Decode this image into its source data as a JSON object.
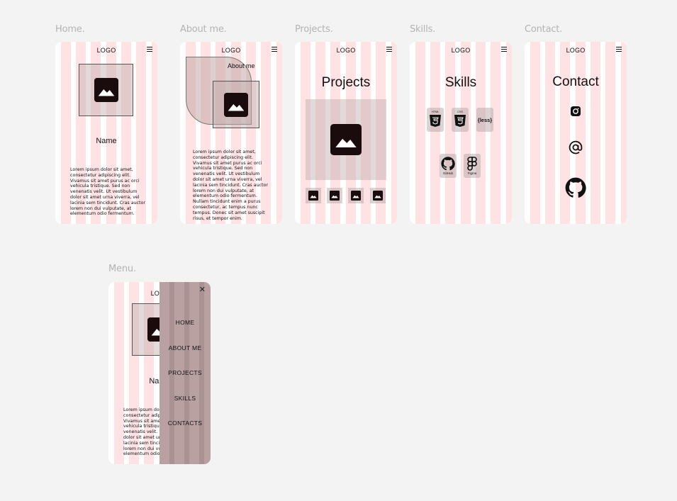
{
  "frames": {
    "home": {
      "label": "Home.",
      "logo": "LOGO",
      "name": "Name",
      "text": "Lorem ipsum dolor sit amet, consectetur adipiscing elit. Vivamus sit amet purus ac orci vehicula tristique. Sed non venenatis velit. Ut vestibulum dolor sit amet urna viverra, vel lacinia sem tincidunt. Cras auctor lorem non dui vulputate, at elementum odio fermentum."
    },
    "about": {
      "label": "About me.",
      "logo": "LOGO",
      "heading": "About  me",
      "text": "Lorem ipsum dolor sit amet, consectetur adipiscing elit. Vivamus sit amet purus ac orci vehicula tristique. Sed non venenatis velit. Ut vestibulum dolor sit amet urna viverra, vel lacinia sem tincidunt. Cras auctor lorem non dui vulputate, at elementum odio fermentum. Nullam tincidunt enim a purus consectetur, ac tempus nunc tempus. Donec sit amet suscipit risus, et tempor enim."
    },
    "projects": {
      "label": "Projects.",
      "logo": "LOGO",
      "title": "Projects"
    },
    "skills": {
      "label": "Skills.",
      "logo": "LOGO",
      "title": "Skills",
      "items": [
        {
          "icon": "html5-icon",
          "badge": "HTML"
        },
        {
          "icon": "css3-icon",
          "badge": "CSS"
        },
        {
          "icon": "less-icon",
          "badge": "{less}"
        },
        {
          "icon": "github-icon",
          "caption": "GitHub"
        },
        {
          "icon": "figma-icon",
          "caption": "Figma"
        }
      ]
    },
    "contact": {
      "label": "Contact.",
      "logo": "LOGO",
      "title": "Contact",
      "icons": [
        "instagram-icon",
        "at-sign-icon",
        "github-icon"
      ]
    },
    "menu": {
      "label": "Menu.",
      "logo": "LOGO",
      "name": "Name",
      "text": "Lorem ipsum dolor sit amet, consectetur adipiscing elit. Vivamus sit amet purus ac orci vehicula tristique. Sed non venenatis velit. Ut vestibulum dolor sit amet urna viverra, vel lacinia sem tincidunt. Cras auctor lorem non dui vulputate, at elementum odio fermentum.",
      "items": [
        "HOME",
        "ABOUT ME",
        "PROJECTS",
        "SKILLS",
        "CONTACTS"
      ]
    }
  },
  "colors": {
    "background": "#f3f3f3",
    "stripe": "#ffe2e3",
    "menu_panel": "#b9a0a1",
    "image_box": "#d8c8c8"
  }
}
